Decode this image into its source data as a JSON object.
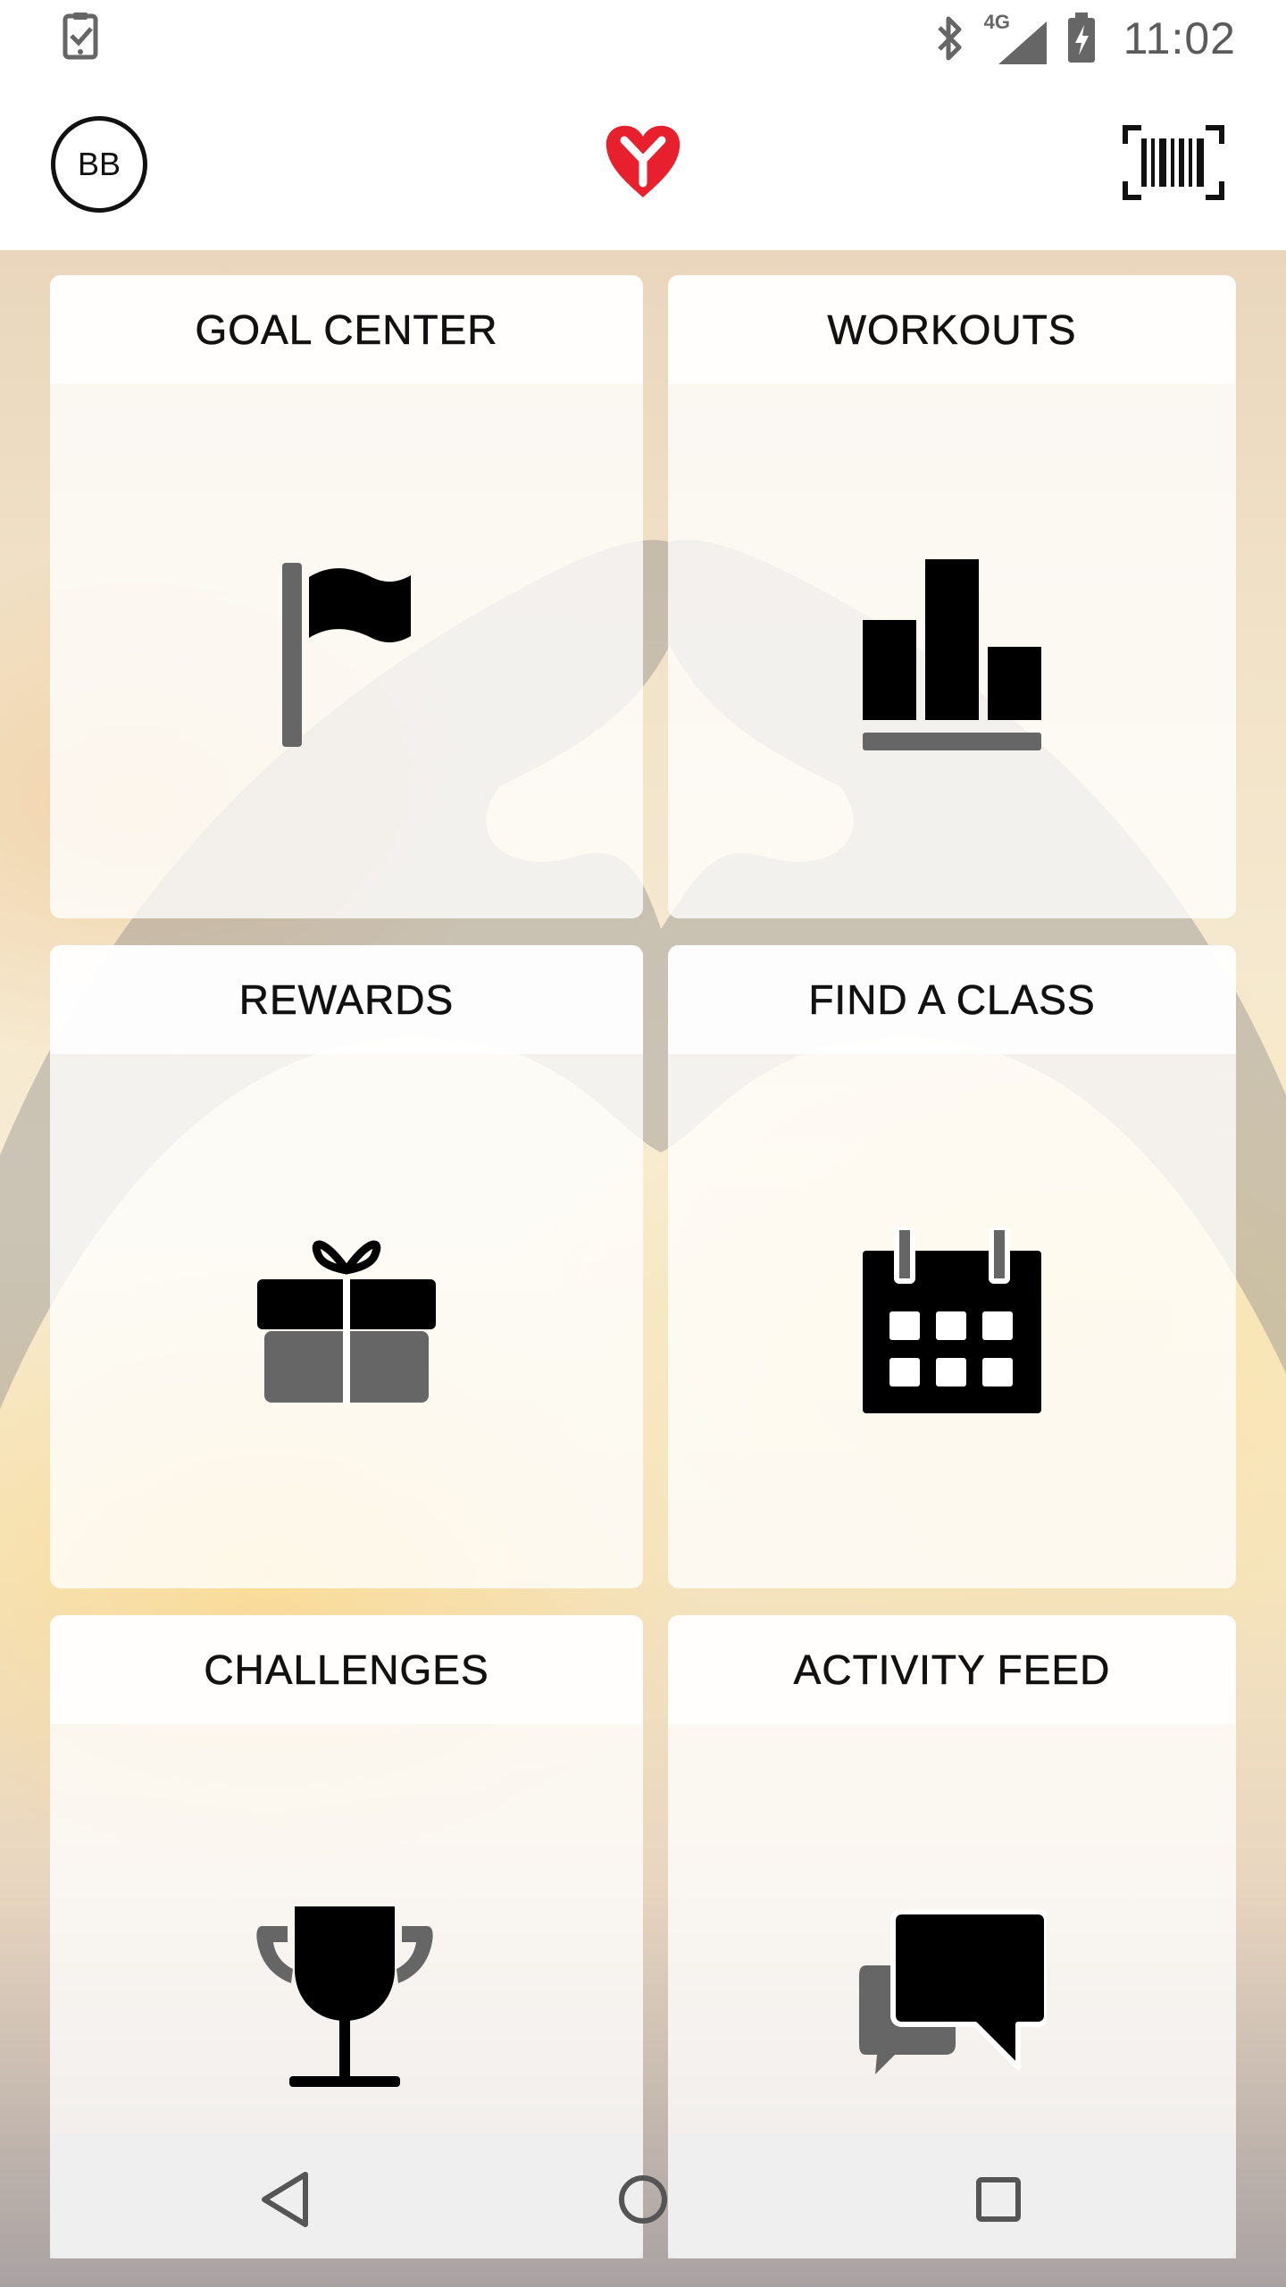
{
  "status_bar": {
    "time": "11:02",
    "network_label": "4G",
    "icons": [
      "task-check-icon",
      "bluetooth-icon",
      "signal-icon",
      "battery-charging-icon"
    ]
  },
  "header": {
    "avatar_initials": "BB",
    "logo_icon": "ymca-heart-logo",
    "barcode_icon": "barcode-icon",
    "accent_color": "#e8202e"
  },
  "tiles": [
    {
      "label": "GOAL CENTER",
      "icon": "flag-icon"
    },
    {
      "label": "WORKOUTS",
      "icon": "bar-chart-icon"
    },
    {
      "label": "REWARDS",
      "icon": "gift-icon"
    },
    {
      "label": "FIND A CLASS",
      "icon": "calendar-icon"
    },
    {
      "label": "CHALLENGES",
      "icon": "trophy-icon"
    },
    {
      "label": "ACTIVITY FEED",
      "icon": "chat-bubbles-icon"
    }
  ],
  "nav": {
    "buttons": [
      "back-icon",
      "home-icon",
      "recents-icon"
    ]
  }
}
